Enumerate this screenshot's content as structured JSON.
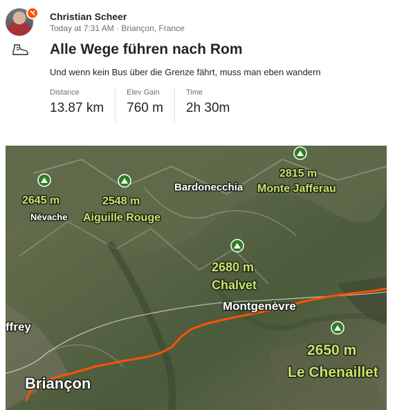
{
  "athlete": {
    "name": "Christian Scheer"
  },
  "activity": {
    "meta": "Today at 7:31 AM · Briançon, France",
    "type_icon": "hiking-boot-icon",
    "title": "Alle Wege führen nach Rom",
    "description": "Und wenn kein Bus über die Grenze fährt, muss man eben wandern",
    "stats": [
      {
        "label": "Distance",
        "value": "13.87 km"
      },
      {
        "label": "Elev Gain",
        "value": "760 m"
      },
      {
        "label": "Time",
        "value": "2h 30m"
      }
    ]
  },
  "map": {
    "route_color": "#fc5200",
    "peaks": [
      {
        "elev": "2645 m",
        "name": "Névache"
      },
      {
        "elev": "2548 m",
        "name": "Aiguille Rouge"
      },
      {
        "elev": "2815 m",
        "name": "Monte Jafferau"
      },
      {
        "elev": "2680 m",
        "name": "Chalvet"
      },
      {
        "elev": "2650 m",
        "name": "Le Chenaillet"
      }
    ],
    "places": [
      "Bardonecchia",
      "Montgenèvre",
      "Briançon",
      "ffrey"
    ]
  },
  "colors": {
    "brand": "#fc5200",
    "text": "#242428",
    "muted": "#6d6d78"
  }
}
